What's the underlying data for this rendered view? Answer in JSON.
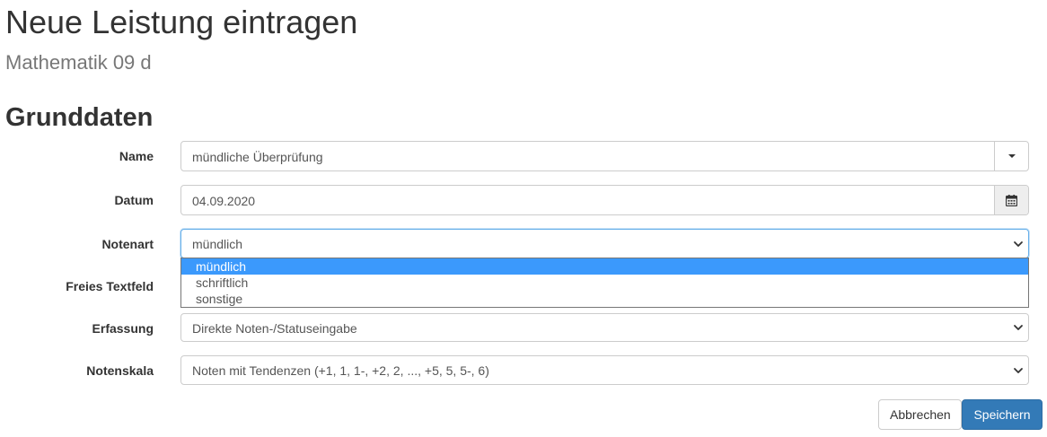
{
  "header": {
    "title": "Neue Leistung eintragen",
    "subtitle": "Mathematik 09 d"
  },
  "section": {
    "title": "Grunddaten"
  },
  "form": {
    "name": {
      "label": "Name",
      "value": "mündliche Überprüfung"
    },
    "datum": {
      "label": "Datum",
      "value": "04.09.2020",
      "icon": "calendar-icon"
    },
    "notenart": {
      "label": "Notenart",
      "value": "mündlich",
      "options": [
        "mündlich",
        "schriftlich",
        "sonstige"
      ],
      "highlighted_index": 0
    },
    "freies_textfeld": {
      "label": "Freies Textfeld"
    },
    "erfassung": {
      "label": "Erfassung",
      "value": "Direkte Noten-/Statuseingabe"
    },
    "notenskala": {
      "label": "Notenskala",
      "value": "Noten mit Tendenzen (+1, 1, 1-, +2, 2, ..., +5, 5, 5-, 6)"
    }
  },
  "actions": {
    "cancel_label": "Abbrechen",
    "save_label": "Speichern"
  },
  "colors": {
    "primary": "#337ab7",
    "option_highlight": "#3b99fc",
    "focus_border": "#66afe9"
  }
}
